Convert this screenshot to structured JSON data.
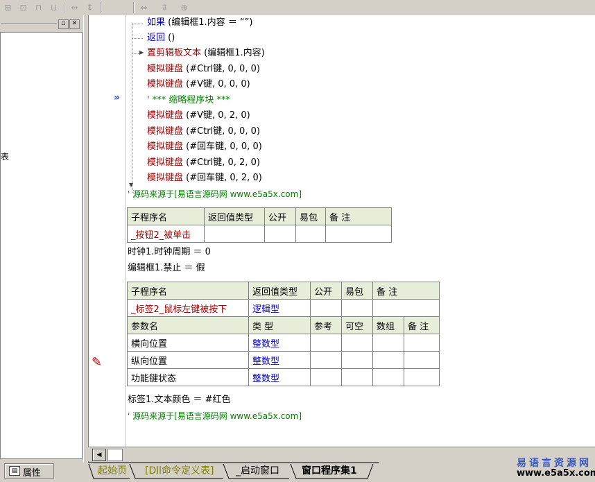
{
  "toolbar": {
    "icons": [
      "align-icon",
      "align-center-icon",
      "align-top-icon",
      "align-bottom-icon",
      "spacing-h-icon",
      "spacing-v-icon",
      "width-icon",
      "height-icon",
      "center-icon"
    ]
  },
  "left_panel": {
    "partial_char": "表"
  },
  "properties_tab": {
    "label": "属性"
  },
  "code": {
    "l1": {
      "kw": "如果",
      "args": " (编辑框1.内容 ＝ “”)"
    },
    "l2": {
      "kw": "返回",
      "args": " ()"
    },
    "l3": {
      "kw": "置剪辑板文本",
      "args": " (编辑框1.内容)"
    },
    "l4": {
      "kw": "模拟键盘",
      "args": " (#Ctrl键, 0, 0, 0)"
    },
    "l5": {
      "kw": "模拟键盘",
      "args": " (#V键, 0, 0, 0)"
    },
    "l6": {
      "text": "' *** 缩略程序块 ***"
    },
    "l7": {
      "kw": "模拟键盘",
      "args": " (#V键, 0, 2, 0)"
    },
    "l8": {
      "kw": "模拟键盘",
      "args": " (#Ctrl键, 0, 0, 0)"
    },
    "l9": {
      "kw": "模拟键盘",
      "args": " (#回车键, 0, 0, 0)"
    },
    "l10": {
      "kw": "模拟键盘",
      "args": " (#Ctrl键, 0, 2, 0)"
    },
    "l11": {
      "kw": "模拟键盘",
      "args": " (#回车键, 0, 2, 0)"
    },
    "comment1": "' 源码来源于[易语言源码网 www.e5a5x.com]",
    "assign1": "时钟1.时钟周期 ＝ 0",
    "assign2": "编辑框1.禁止 ＝ 假",
    "assign3": "标签1.文本颜色 ＝ #红色",
    "comment2": "' 源码来源于[易语言源码网 www.e5a5x.com]"
  },
  "table1": {
    "headers": [
      "子程序名",
      "返回值类型",
      "公开",
      "易包",
      "备 注"
    ],
    "row": [
      "_按钮2_被单击",
      "",
      "",
      "",
      ""
    ]
  },
  "table2": {
    "headers": [
      "子程序名",
      "返回值类型",
      "公开",
      "易包",
      "备 注"
    ],
    "row": [
      "_标签2_鼠标左键被按下",
      "逻辑型",
      "",
      "",
      ""
    ],
    "param_headers": [
      "参数名",
      "类 型",
      "参考",
      "可空",
      "数组",
      "备 注"
    ],
    "params": [
      [
        "横向位置",
        "整数型"
      ],
      [
        "纵向位置",
        "整数型"
      ],
      [
        "功能键状态",
        "整数型"
      ]
    ]
  },
  "tabs": [
    "起始页",
    "[Dll命令定义表]",
    "_启动窗口",
    "窗口程序集1"
  ],
  "logo": {
    "line1": "易语言资源网",
    "line2": "www.e5a5x.com"
  },
  "colors": {
    "keyword": "#0000c8",
    "command": "#a00000",
    "comment": "#008000",
    "table_header": "#e6eeda"
  }
}
